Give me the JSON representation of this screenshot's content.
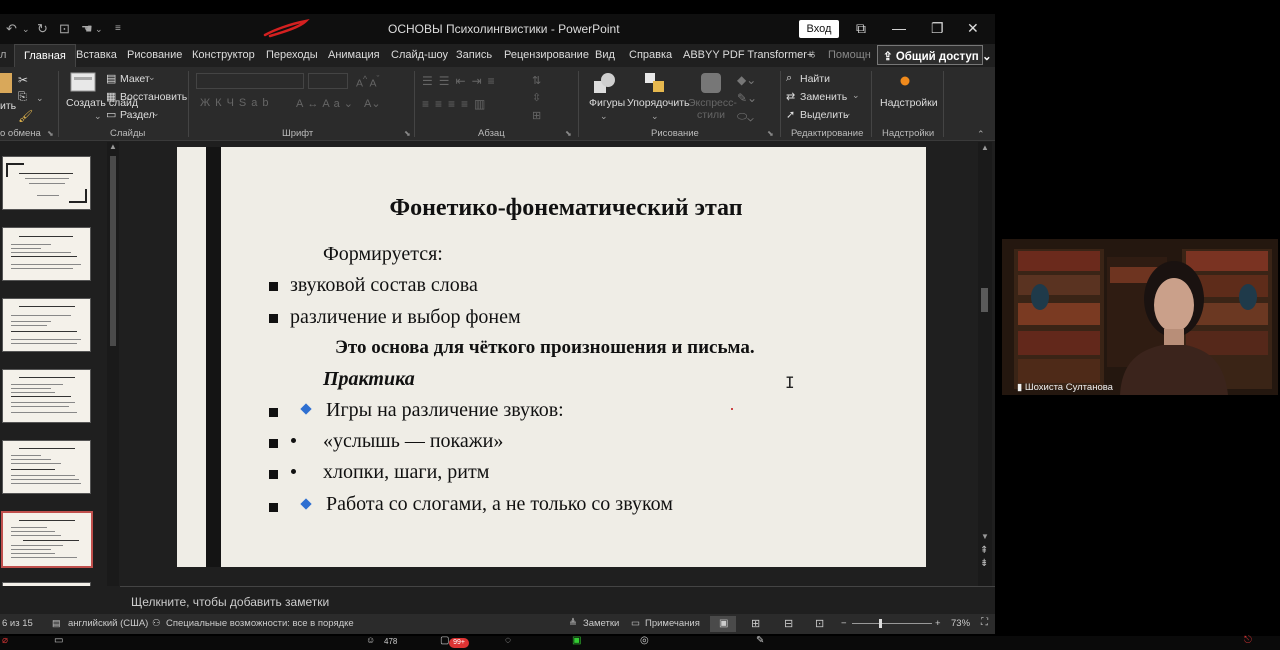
{
  "window": {
    "title": "ОСНОВЫ Психолингвистики  -  PowerPoint",
    "signin_label": "Вход"
  },
  "tabs": [
    "Главная",
    "Вставка",
    "Рисование",
    "Конструктор",
    "Переходы",
    "Анимация",
    "Слайд-шоу",
    "Запись",
    "Рецензирование",
    "Вид",
    "Справка",
    "ABBYY PDF Transformer+",
    "Помощн"
  ],
  "share_label": "Общий доступ",
  "ribbon": {
    "clipboard_group": "о обмена",
    "slides": {
      "create_slide": "Создать слайд",
      "layout": "Макет",
      "reset": "Восстановить",
      "section": "Раздел",
      "group": "Слайды"
    },
    "font_group": "Шрифт",
    "paragraph_group": "Абзац",
    "drawing": {
      "shapes": "Фигуры",
      "arrange": "Упорядочить",
      "quick_styles": "Экспресс-стили",
      "group": "Рисование"
    },
    "editing": {
      "find": "Найти",
      "replace": "Заменить",
      "select": "Выделить",
      "group": "Редактирование"
    },
    "addins": {
      "addins": "Надстройки",
      "group": "Надстройки"
    }
  },
  "slide": {
    "title": "Фонетико-фонематический этап",
    "intro": "Формируется:",
    "bullets": [
      "звуковой состав слова",
      "различение и выбор фонем"
    ],
    "emphasis": "Это основа для чёткого произношения и письма.",
    "practice": "Практика",
    "practice_items": [
      {
        "marker": "diamond",
        "text": "Игры на различение звуков:"
      },
      {
        "marker": "dot",
        "text": "«услышь — покажи»"
      },
      {
        "marker": "dot",
        "text": "хлопки, шаги, ритм"
      },
      {
        "marker": "diamond",
        "text": "Работа со слогами, а не только со звуком"
      }
    ]
  },
  "notes_placeholder": "Щелкните, чтобы добавить заметки",
  "status": {
    "slide_counter": "6 из 15",
    "language": "английский (США)",
    "accessibility": "Специальные возможности: все в порядке",
    "notes": "Заметки",
    "comments": "Примечания",
    "zoom": "73%"
  },
  "video": {
    "participant": "Шохиста Султанова"
  },
  "taskbar": {
    "participants_count": "478",
    "chat_badge": "99+"
  },
  "colors": {
    "accent_red": "#c0504d",
    "diamond_blue": "#2e6fd1",
    "slide_bg": "#efede6"
  }
}
